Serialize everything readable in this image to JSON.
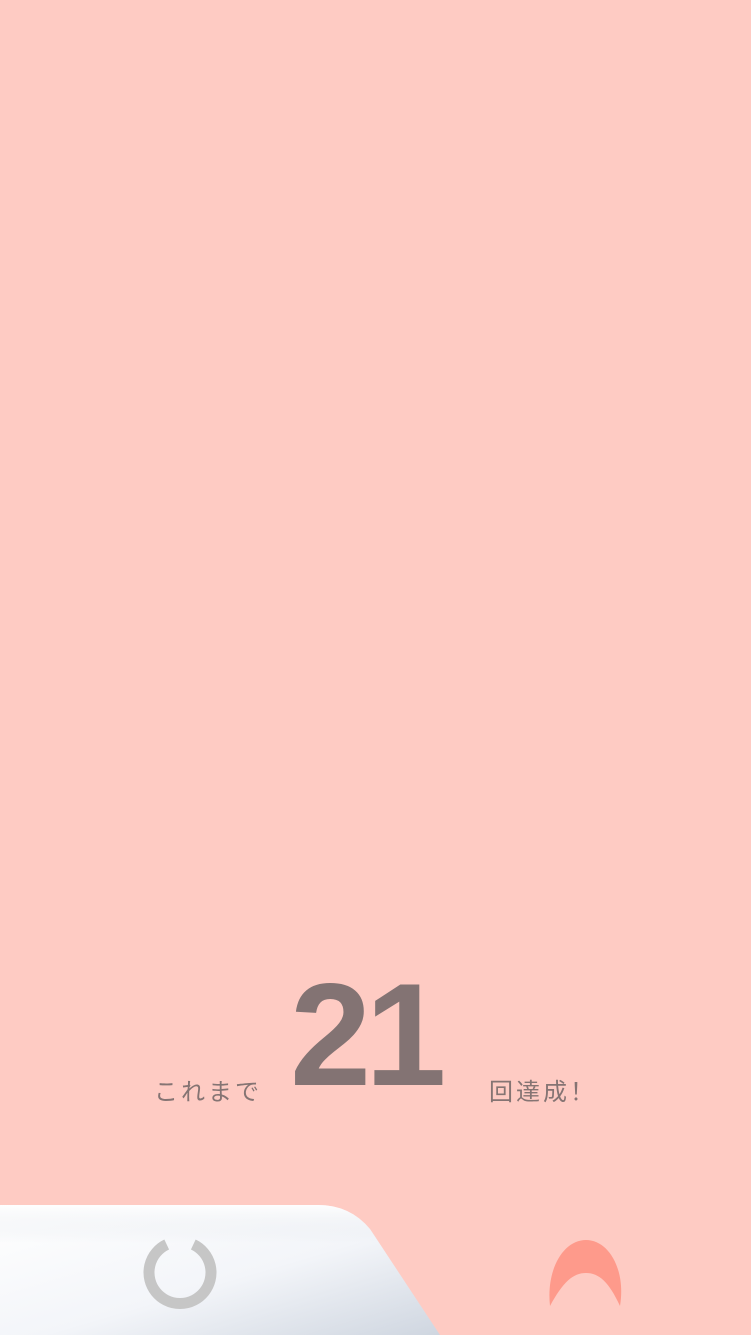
{
  "counter": {
    "prefix": "これまで",
    "count": "21",
    "suffix": "回達成！"
  },
  "icons": {
    "reset": "refresh-icon",
    "mascot": "arch-icon"
  },
  "colors": {
    "background": "#fecbc3",
    "text": "#857473",
    "count": "#837373",
    "mascot": "#fe9a8b",
    "reset_icon": "#c6c6c6"
  }
}
